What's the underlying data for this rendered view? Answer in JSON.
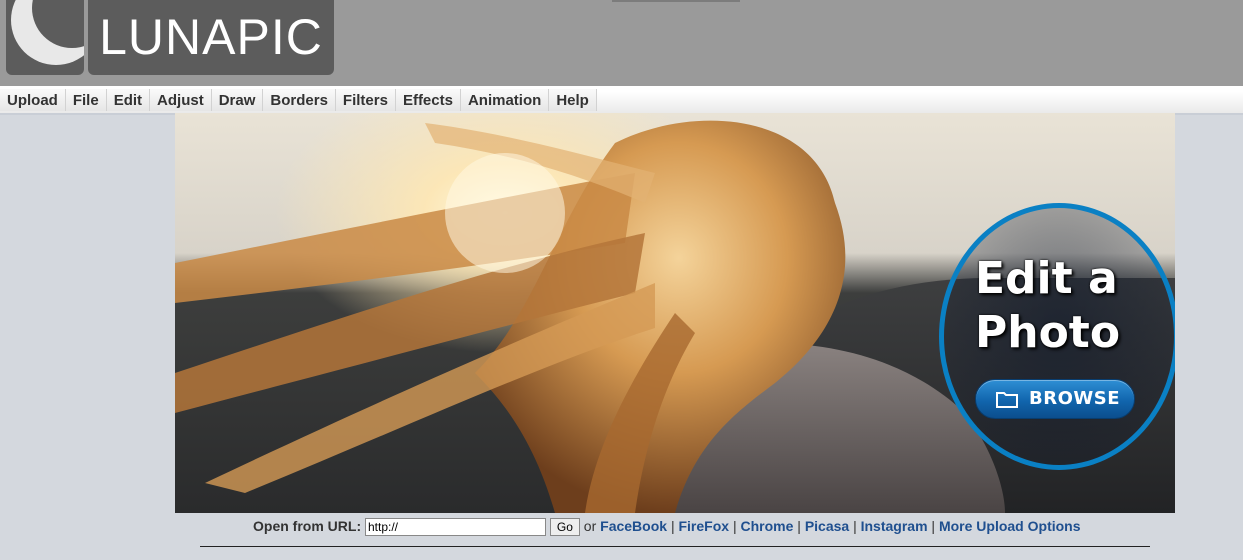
{
  "brand": {
    "logo_text": "LUNAPIC"
  },
  "menu": {
    "items": [
      "Upload",
      "File",
      "Edit",
      "Adjust",
      "Draw",
      "Borders",
      "Filters",
      "Effects",
      "Animation",
      "Help"
    ]
  },
  "hero": {
    "headline_line1": "Edit a",
    "headline_line2": "Photo",
    "browse_label": "BROWSE"
  },
  "url_bar": {
    "label": "Open from URL:",
    "input_value": "http://",
    "go_label": "Go",
    "or_text": "or",
    "links": [
      "FaceBook",
      "FireFox",
      "Chrome",
      "Picasa",
      "Instagram",
      "More Upload Options"
    ],
    "separator": "|"
  },
  "colors": {
    "header_bg": "#9a9a9a",
    "page_bg": "#d4d8de",
    "accent_blue": "#0a80c4",
    "link_color": "#1f4f8f"
  },
  "icons": [
    "moon-logo-icon",
    "folder-icon"
  ]
}
